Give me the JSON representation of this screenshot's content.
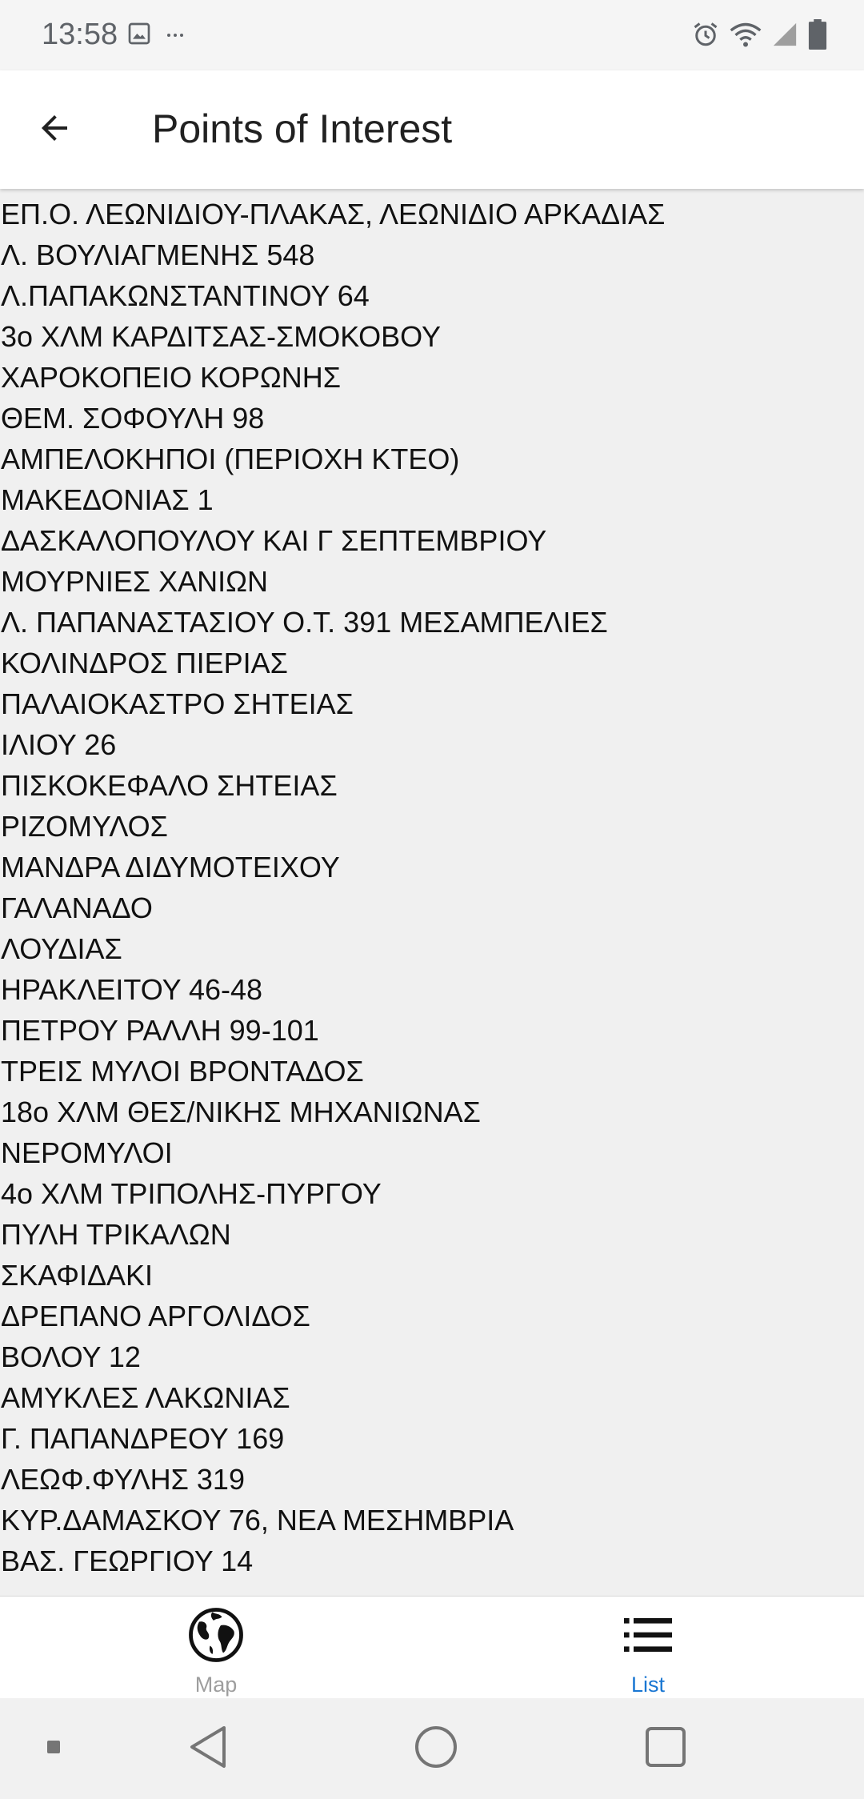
{
  "status_bar": {
    "time": "13:58",
    "left_icons": [
      "image-icon",
      "more-dots-icon"
    ],
    "right_icons": [
      "alarm-icon",
      "wifi-icon",
      "signal-icon",
      "battery-icon"
    ]
  },
  "app_bar": {
    "title": "Points of Interest",
    "back_icon": "arrow-back-icon"
  },
  "poi_list": {
    "items": [
      "ΕΠ.Ο. ΛΕΩΝΙΔΙΟΥ-ΠΛΑΚΑΣ, ΛΕΩΝΙΔΙΟ ΑΡΚΑΔΙΑΣ",
      "Λ. ΒΟΥΛΙΑΓΜΕΝΗΣ 548",
      "Λ.ΠΑΠΑΚΩΝΣΤΑΝΤΙΝΟΥ 64",
      "3ο ΧΛΜ ΚΑΡΔΙΤΣΑΣ-ΣΜΟΚΟΒΟΥ",
      "ΧΑΡΟΚΟΠΕΙΟ ΚΟΡΩΝΗΣ",
      "ΘΕΜ. ΣΟΦΟΥΛΗ 98",
      "ΑΜΠΕΛΟΚΗΠΟΙ (ΠΕΡΙΟΧΗ ΚΤΕΟ)",
      "ΜΑΚΕΔΟΝΙΑΣ 1",
      "ΔΑΣΚΑΛΟΠΟΥΛΟΥ ΚΑΙ Γ ΣΕΠΤΕΜΒΡΙΟΥ",
      "ΜΟΥΡΝΙΕΣ ΧΑΝΙΩΝ",
      "Λ. ΠΑΠΑΝΑΣΤΑΣΙΟΥ Ο.Τ. 391 ΜΕΣΑΜΠΕΛΙΕΣ",
      "ΚΟΛΙΝΔΡΟΣ ΠΙΕΡΙΑΣ",
      "ΠΑΛΑΙΟΚΑΣΤΡΟ ΣΗΤΕΙΑΣ",
      "ΙΛΙΟΥ 26",
      "ΠΙΣΚΟΚΕΦΑΛΟ ΣΗΤΕΙΑΣ",
      "ΡΙΖΟΜΥΛΟΣ",
      "ΜΑΝΔΡΑ ΔΙΔΥΜΟΤΕΙΧΟΥ",
      "ΓΑΛΑΝΑΔΟ",
      "ΛΟΥΔΙΑΣ",
      "ΗΡΑΚΛΕΙΤΟΥ 46-48",
      "ΠΕΤΡΟΥ ΡΑΛΛΗ 99-101",
      "ΤΡΕΙΣ ΜΥΛΟΙ ΒΡΟΝΤΑΔΟΣ",
      "18ο ΧΛΜ ΘΕΣ/ΝΙΚΗΣ ΜΗΧΑΝΙΩΝΑΣ",
      "ΝΕΡΟΜΥΛΟΙ",
      "4ο ΧΛΜ ΤΡΙΠΟΛΗΣ-ΠΥΡΓΟΥ",
      "ΠΥΛΗ ΤΡΙΚΑΛΩΝ",
      "ΣΚΑΦΙΔΑΚΙ",
      "ΔΡΕΠΑΝΟ ΑΡΓΟΛΙΔΟΣ",
      "ΒΟΛΟΥ 12",
      "ΑΜΥΚΛΕΣ ΛΑΚΩΝΙΑΣ",
      "Γ. ΠΑΠΑΝΔΡΕΟΥ 169",
      "ΛΕΩΦ.ΦΥΛΗΣ 319",
      "ΚΥΡ.ΔΑΜΑΣΚΟΥ 76, ΝΕΑ ΜΕΣΗΜΒΡΙΑ",
      "ΒΑΣ. ΓΕΩΡΓΙΟΥ 14"
    ]
  },
  "bottom_nav": {
    "map": {
      "label": "Map",
      "icon": "globe-icon",
      "color": "#9e9e9e"
    },
    "list": {
      "label": "List",
      "icon": "list-icon",
      "color": "#1976d2",
      "selected": true
    }
  },
  "system_nav": {
    "buttons": [
      "recents-dot-icon",
      "back-triangle-icon",
      "home-circle-icon",
      "overview-square-icon"
    ]
  }
}
